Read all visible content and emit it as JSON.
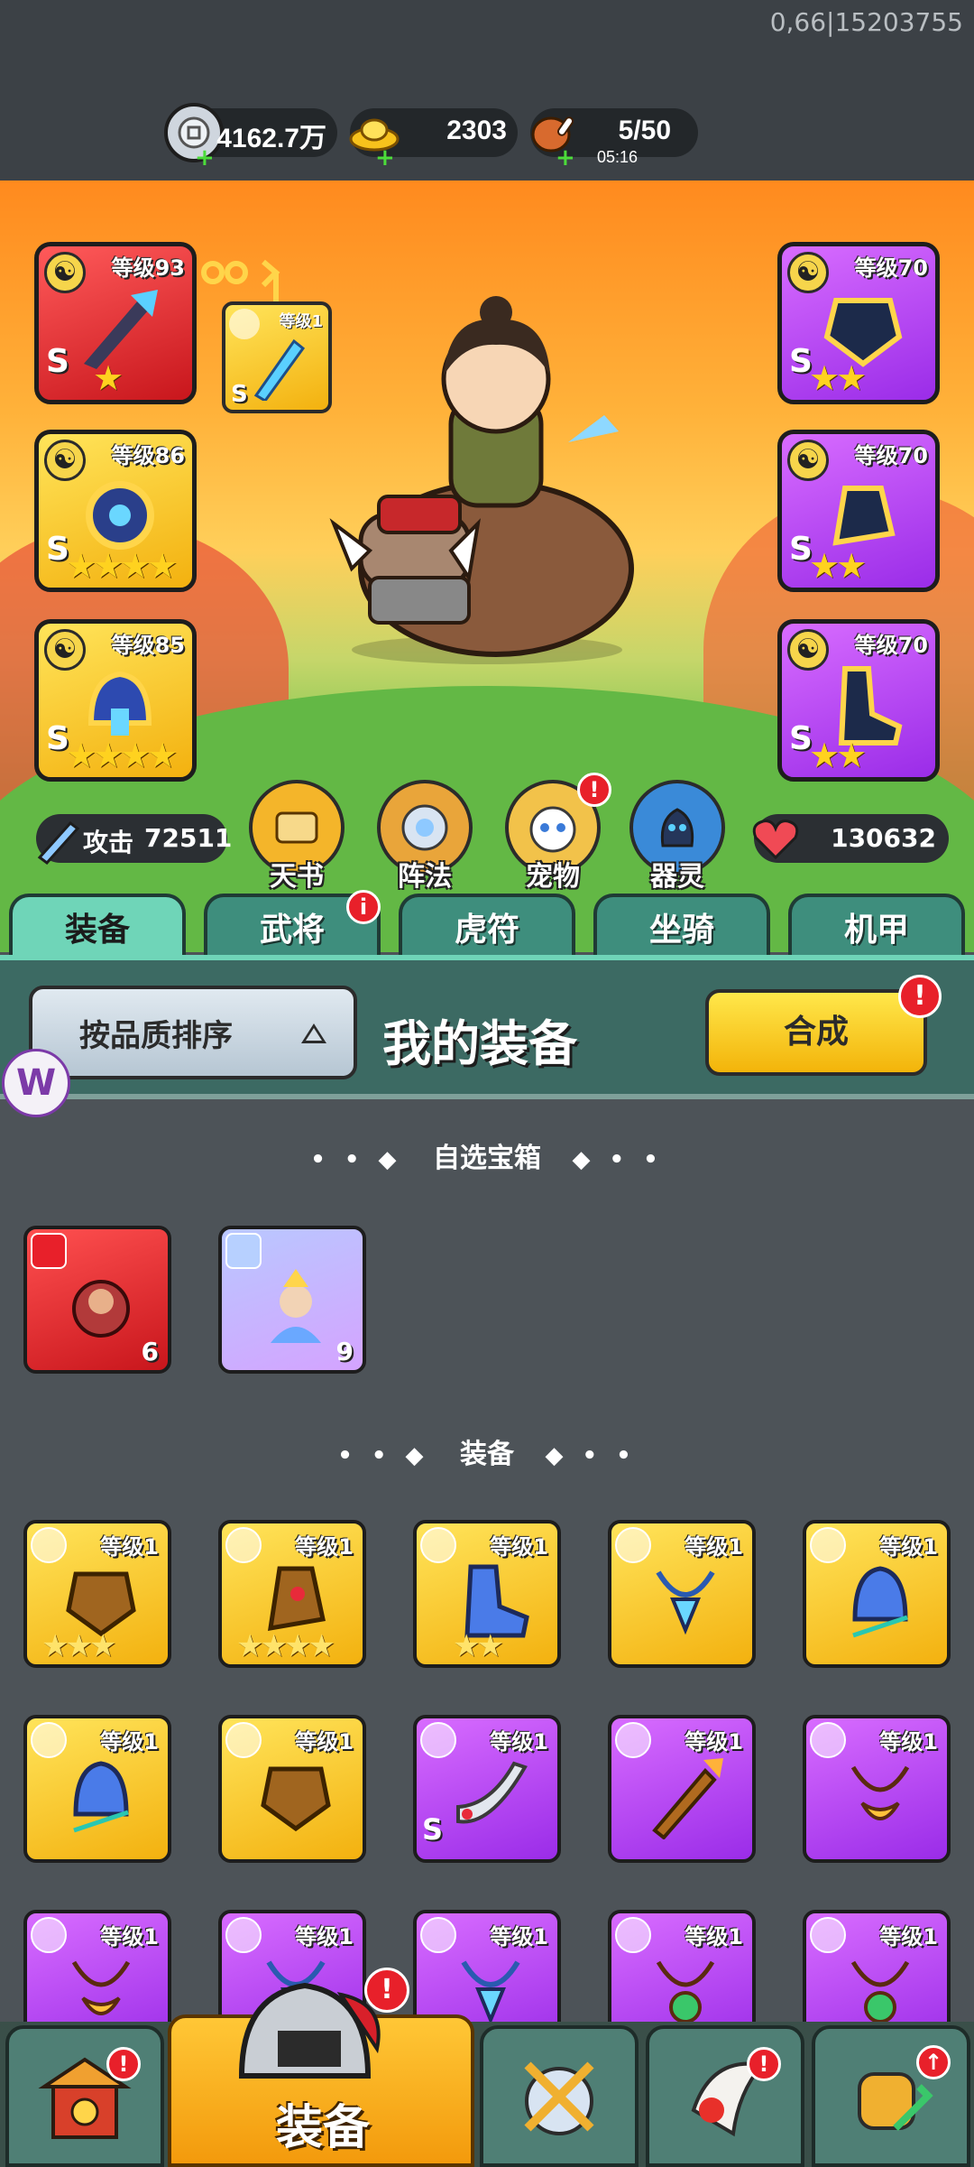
{
  "status": {
    "debug_text": "0,66|15203755"
  },
  "resources": [
    {
      "name": "silver",
      "value": "4162.7万",
      "sub": ""
    },
    {
      "name": "gold-ingot",
      "value": "2303",
      "sub": ""
    },
    {
      "name": "stamina",
      "value": "5/50",
      "sub": "05:16"
    }
  ],
  "hero": {
    "left_slots": [
      {
        "level": "等级93",
        "grade": "S",
        "stars": 1,
        "quality": "red"
      },
      {
        "level": "等级86",
        "grade": "S",
        "stars": 4,
        "quality": "gold"
      },
      {
        "level": "等级85",
        "grade": "S",
        "stars": 4,
        "quality": "gold"
      }
    ],
    "linked_slot": {
      "level": "等级1",
      "grade": "S"
    },
    "right_slots": [
      {
        "level": "等级70",
        "grade": "S",
        "stars": 2,
        "quality": "purple"
      },
      {
        "level": "等级70",
        "grade": "S",
        "stars": 2,
        "quality": "purple"
      },
      {
        "level": "等级70",
        "grade": "S",
        "stars": 2,
        "quality": "purple"
      }
    ],
    "attack_label": "攻击",
    "attack_value": "72511",
    "hp_value": "130632",
    "functions": [
      {
        "label": "天书",
        "badge": ""
      },
      {
        "label": "阵法",
        "badge": ""
      },
      {
        "label": "宠物",
        "badge": "!"
      },
      {
        "label": "器灵",
        "badge": ""
      }
    ]
  },
  "tabs": [
    {
      "label": "装备",
      "active": true,
      "badge": ""
    },
    {
      "label": "武将",
      "active": false,
      "badge": "i"
    },
    {
      "label": "虎符",
      "active": false,
      "badge": ""
    },
    {
      "label": "坐骑",
      "active": false,
      "badge": ""
    },
    {
      "label": "机甲",
      "active": false,
      "badge": ""
    }
  ],
  "panel": {
    "sort_label": "按品质排序",
    "title": "我的装备",
    "craft_label": "合成",
    "craft_badge": "!"
  },
  "sections": {
    "chest_title": "自选宝箱",
    "equip_title": "装备",
    "dots_left": "• • ◆",
    "dots_right": "◆ • •"
  },
  "chests": [
    {
      "count": "6",
      "quality": "red"
    },
    {
      "count": "9",
      "quality": "lavender"
    }
  ],
  "equipment": [
    {
      "level": "等级1",
      "quality": "gold",
      "stars": 3,
      "grade": ""
    },
    {
      "level": "等级1",
      "quality": "gold",
      "stars": 4,
      "grade": ""
    },
    {
      "level": "等级1",
      "quality": "gold",
      "stars": 2,
      "grade": ""
    },
    {
      "level": "等级1",
      "quality": "gold",
      "stars": 0,
      "grade": ""
    },
    {
      "level": "等级1",
      "quality": "gold",
      "stars": 0,
      "grade": ""
    },
    {
      "level": "等级1",
      "quality": "gold",
      "stars": 0,
      "grade": ""
    },
    {
      "level": "等级1",
      "quality": "gold",
      "stars": 0,
      "grade": ""
    },
    {
      "level": "等级1",
      "quality": "purple",
      "stars": 0,
      "grade": "S"
    },
    {
      "level": "等级1",
      "quality": "purple",
      "stars": 0,
      "grade": ""
    },
    {
      "level": "等级1",
      "quality": "purple",
      "stars": 0,
      "grade": ""
    },
    {
      "level": "等级1",
      "quality": "purple",
      "stars": 0,
      "grade": ""
    },
    {
      "level": "等级1",
      "quality": "purple",
      "stars": 0,
      "grade": ""
    },
    {
      "level": "等级1",
      "quality": "purple",
      "stars": 0,
      "grade": ""
    },
    {
      "level": "等级1",
      "quality": "purple",
      "stars": 0,
      "grade": ""
    },
    {
      "level": "等级1",
      "quality": "purple",
      "stars": 0,
      "grade": ""
    }
  ],
  "bottom_nav": {
    "active_label": "装备",
    "items": [
      {
        "name": "shop",
        "badge": "!"
      },
      {
        "name": "equipment",
        "badge": "!"
      },
      {
        "name": "battle",
        "badge": ""
      },
      {
        "name": "pet",
        "badge": "!"
      },
      {
        "name": "upgrade",
        "badge": "↑"
      }
    ]
  },
  "colors": {
    "accent_gold": "#f3b10f",
    "quality_purple": "#9a2ce8",
    "quality_red": "#c8161c",
    "tab_teal": "#3e8e7d",
    "badge_red": "#e8202a"
  }
}
